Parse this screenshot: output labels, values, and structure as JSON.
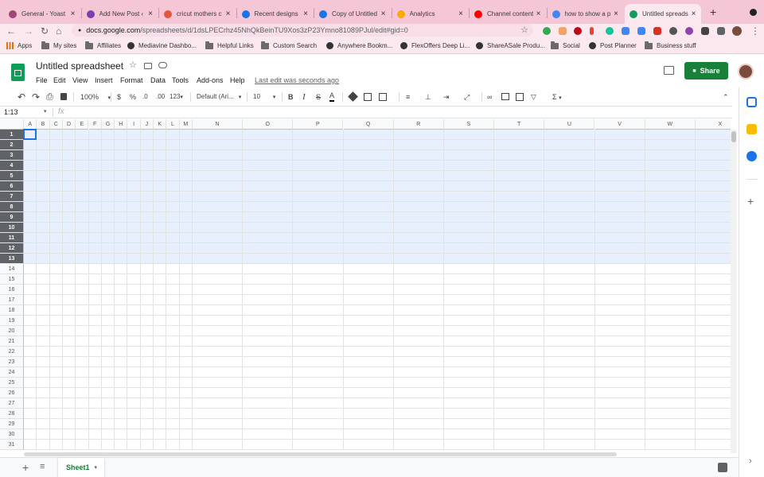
{
  "browser": {
    "tabs": [
      {
        "label": "General - Yoast",
        "color": "#a0457a",
        "icon": "yoast-icon"
      },
      {
        "label": "Add New Post ‹",
        "color": "#7b3fb0",
        "icon": "wordpress-icon"
      },
      {
        "label": "cricut mothers c",
        "color": "#e3573c",
        "icon": "bing-icon"
      },
      {
        "label": "Recent designs",
        "color": "#1a73e8",
        "icon": "canva-icon"
      },
      {
        "label": "Copy of Untitled",
        "color": "#1a73e8",
        "icon": "canva-icon"
      },
      {
        "label": "Analytics",
        "color": "#f9ab00",
        "icon": "analytics-icon"
      },
      {
        "label": "Channel content",
        "color": "#ff0000",
        "icon": "youtube-icon"
      },
      {
        "label": "how to show a p",
        "color": "#4285f4",
        "icon": "google-icon"
      },
      {
        "label": "Untitled spreads",
        "color": "#0f9d58",
        "icon": "sheets-icon",
        "active": true
      }
    ],
    "close_glyph": "×",
    "new_tab_glyph": "+",
    "url_host": "docs.google.com",
    "url_path": "/spreadsheets/d/1dsLPECrhz45NhQkBeinTU9Xos3zP23Ymno81089PJul/edit#gid=0",
    "back_glyph": "←",
    "forward_glyph": "→",
    "reload_glyph": "↻",
    "home_glyph": "⌂",
    "lock_glyph": "🔒",
    "star_glyph": "☆",
    "menu_glyph": "⋮"
  },
  "bookmarks": [
    {
      "label": "Apps",
      "type": "apps"
    },
    {
      "label": "My sites",
      "type": "folder"
    },
    {
      "label": "Affiliates",
      "type": "folder"
    },
    {
      "label": "Mediavine Dashbo...",
      "type": "site"
    },
    {
      "label": "Helpful Links",
      "type": "folder"
    },
    {
      "label": "Custom Search",
      "type": "folder"
    },
    {
      "label": "Anywhere Bookm...",
      "type": "site"
    },
    {
      "label": "FlexOffers Deep Li...",
      "type": "site"
    },
    {
      "label": "ShareASale Produ...",
      "type": "site"
    },
    {
      "label": "Social",
      "type": "folder"
    },
    {
      "label": "Post Planner",
      "type": "site"
    },
    {
      "label": "Business stuff",
      "type": "folder"
    }
  ],
  "app": {
    "title": "Untitled spreadsheet",
    "menus": [
      "File",
      "Edit",
      "View",
      "Insert",
      "Format",
      "Data",
      "Tools",
      "Add-ons",
      "Help"
    ],
    "last_edit": "Last edit was seconds ago",
    "share_label": "Share",
    "accent": "#188038"
  },
  "toolbar": {
    "undo": "↶",
    "redo": "↷",
    "print": "⎙",
    "paint": "🖌",
    "zoom": "100%",
    "currency": "$",
    "percent": "%",
    "dec_less": ".0",
    "dec_more": ".00",
    "format_more": "123",
    "font": "Default (Ari...",
    "font_size": "10",
    "bold": "B",
    "italic": "I",
    "strike": "S",
    "text_color": "A",
    "functions": "Σ",
    "caret": "▾",
    "collapse": "⌃"
  },
  "formula": {
    "name_box": "1:13",
    "fx": "fx"
  },
  "grid": {
    "columns": [
      "A",
      "B",
      "C",
      "D",
      "E",
      "F",
      "G",
      "H",
      "I",
      "J",
      "K",
      "L",
      "M",
      "N",
      "O",
      "P",
      "Q",
      "R",
      "S",
      "T",
      "U",
      "V",
      "W",
      "X"
    ],
    "rows": [
      "1",
      "2",
      "3",
      "4",
      "5",
      "6",
      "7",
      "8",
      "9",
      "10",
      "11",
      "12",
      "13",
      "14",
      "15",
      "16",
      "17",
      "18",
      "19",
      "20",
      "21",
      "22",
      "23",
      "24",
      "25",
      "26",
      "27",
      "28",
      "29",
      "30",
      "31"
    ],
    "selected_rows": [
      1,
      13
    ],
    "selection_color": "#1a73e8"
  },
  "sheets": {
    "active": "Sheet1",
    "add_glyph": "+",
    "list_glyph": "≡"
  }
}
